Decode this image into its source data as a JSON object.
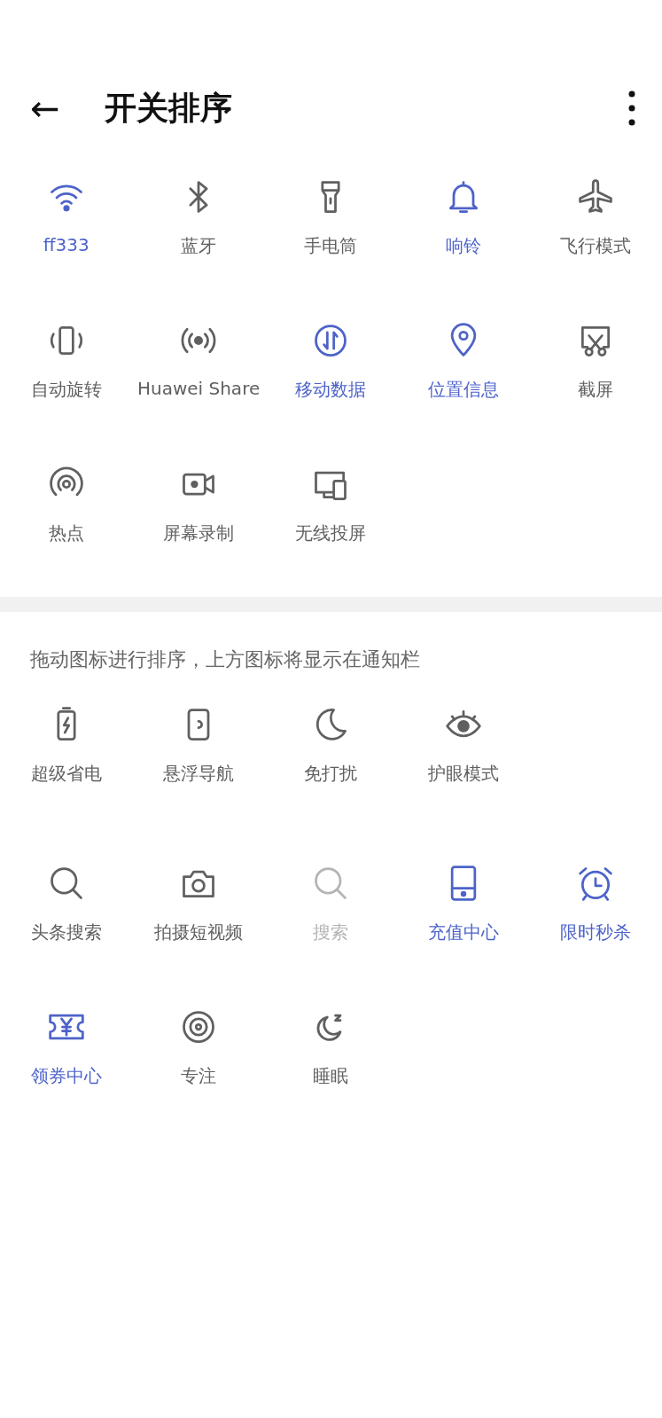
{
  "header": {
    "back": "←",
    "title": "开关排序"
  },
  "active_switches": [
    {
      "kind": "wifi",
      "label": "ff333",
      "on": true,
      "disabled": false
    },
    {
      "kind": "bluetooth",
      "label": "蓝牙",
      "on": false,
      "disabled": false
    },
    {
      "kind": "flashlight",
      "label": "手电筒",
      "on": false,
      "disabled": false
    },
    {
      "kind": "bell",
      "label": "响铃",
      "on": true,
      "disabled": false
    },
    {
      "kind": "airplane",
      "label": "飞行模式",
      "on": false,
      "disabled": false
    },
    {
      "kind": "rotate",
      "label": "自动旋转",
      "on": false,
      "disabled": false
    },
    {
      "kind": "share",
      "label": "Huawei Share",
      "on": false,
      "disabled": false
    },
    {
      "kind": "data",
      "label": "移动数据",
      "on": true,
      "disabled": false
    },
    {
      "kind": "location",
      "label": "位置信息",
      "on": true,
      "disabled": false
    },
    {
      "kind": "screenshot",
      "label": "截屏",
      "on": false,
      "disabled": false
    },
    {
      "kind": "hotspot",
      "label": "热点",
      "on": false,
      "disabled": false
    },
    {
      "kind": "record",
      "label": "屏幕录制",
      "on": false,
      "disabled": false
    },
    {
      "kind": "cast",
      "label": "无线投屏",
      "on": false,
      "disabled": false
    }
  ],
  "hint": "拖动图标进行排序，上方图标将显示在通知栏",
  "other_switches": [
    {
      "kind": "battery",
      "label": "超级省电",
      "on": false,
      "disabled": false
    },
    {
      "kind": "floatnav",
      "label": "悬浮导航",
      "on": false,
      "disabled": false
    },
    {
      "kind": "moon",
      "label": "免打扰",
      "on": false,
      "disabled": false
    },
    {
      "kind": "eye",
      "label": "护眼模式",
      "on": false,
      "disabled": false
    },
    {
      "kind": "newline"
    },
    {
      "kind": "search",
      "label": "头条搜索",
      "on": false,
      "disabled": false
    },
    {
      "kind": "camera",
      "label": "拍摄短视频",
      "on": false,
      "disabled": false
    },
    {
      "kind": "search",
      "label": "搜索",
      "on": false,
      "disabled": true
    },
    {
      "kind": "tablet",
      "label": "充值中心",
      "on": true,
      "disabled": false
    },
    {
      "kind": "alarm",
      "label": "限时秒杀",
      "on": true,
      "disabled": false
    },
    {
      "kind": "coupon",
      "label": "领券中心",
      "on": true,
      "disabled": false
    },
    {
      "kind": "focus",
      "label": "专注",
      "on": false,
      "disabled": false
    },
    {
      "kind": "sleep",
      "label": "睡眠",
      "on": false,
      "disabled": false
    }
  ]
}
